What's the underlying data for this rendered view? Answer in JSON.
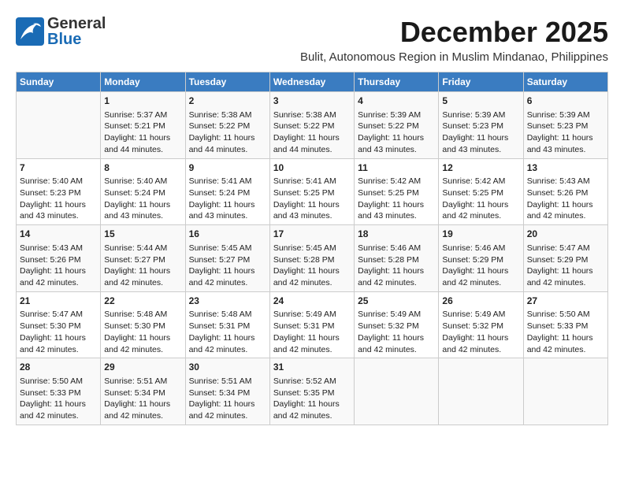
{
  "header": {
    "logo_general": "General",
    "logo_blue": "Blue",
    "month_title": "December 2025",
    "subtitle": "Bulit, Autonomous Region in Muslim Mindanao, Philippines"
  },
  "days_of_week": [
    "Sunday",
    "Monday",
    "Tuesday",
    "Wednesday",
    "Thursday",
    "Friday",
    "Saturday"
  ],
  "weeks": [
    [
      {
        "day": "",
        "info": ""
      },
      {
        "day": "1",
        "info": "Sunrise: 5:37 AM\nSunset: 5:21 PM\nDaylight: 11 hours and 44 minutes."
      },
      {
        "day": "2",
        "info": "Sunrise: 5:38 AM\nSunset: 5:22 PM\nDaylight: 11 hours and 44 minutes."
      },
      {
        "day": "3",
        "info": "Sunrise: 5:38 AM\nSunset: 5:22 PM\nDaylight: 11 hours and 44 minutes."
      },
      {
        "day": "4",
        "info": "Sunrise: 5:39 AM\nSunset: 5:22 PM\nDaylight: 11 hours and 43 minutes."
      },
      {
        "day": "5",
        "info": "Sunrise: 5:39 AM\nSunset: 5:23 PM\nDaylight: 11 hours and 43 minutes."
      },
      {
        "day": "6",
        "info": "Sunrise: 5:39 AM\nSunset: 5:23 PM\nDaylight: 11 hours and 43 minutes."
      }
    ],
    [
      {
        "day": "7",
        "info": "Sunrise: 5:40 AM\nSunset: 5:23 PM\nDaylight: 11 hours and 43 minutes."
      },
      {
        "day": "8",
        "info": "Sunrise: 5:40 AM\nSunset: 5:24 PM\nDaylight: 11 hours and 43 minutes."
      },
      {
        "day": "9",
        "info": "Sunrise: 5:41 AM\nSunset: 5:24 PM\nDaylight: 11 hours and 43 minutes."
      },
      {
        "day": "10",
        "info": "Sunrise: 5:41 AM\nSunset: 5:25 PM\nDaylight: 11 hours and 43 minutes."
      },
      {
        "day": "11",
        "info": "Sunrise: 5:42 AM\nSunset: 5:25 PM\nDaylight: 11 hours and 43 minutes."
      },
      {
        "day": "12",
        "info": "Sunrise: 5:42 AM\nSunset: 5:25 PM\nDaylight: 11 hours and 42 minutes."
      },
      {
        "day": "13",
        "info": "Sunrise: 5:43 AM\nSunset: 5:26 PM\nDaylight: 11 hours and 42 minutes."
      }
    ],
    [
      {
        "day": "14",
        "info": "Sunrise: 5:43 AM\nSunset: 5:26 PM\nDaylight: 11 hours and 42 minutes."
      },
      {
        "day": "15",
        "info": "Sunrise: 5:44 AM\nSunset: 5:27 PM\nDaylight: 11 hours and 42 minutes."
      },
      {
        "day": "16",
        "info": "Sunrise: 5:45 AM\nSunset: 5:27 PM\nDaylight: 11 hours and 42 minutes."
      },
      {
        "day": "17",
        "info": "Sunrise: 5:45 AM\nSunset: 5:28 PM\nDaylight: 11 hours and 42 minutes."
      },
      {
        "day": "18",
        "info": "Sunrise: 5:46 AM\nSunset: 5:28 PM\nDaylight: 11 hours and 42 minutes."
      },
      {
        "day": "19",
        "info": "Sunrise: 5:46 AM\nSunset: 5:29 PM\nDaylight: 11 hours and 42 minutes."
      },
      {
        "day": "20",
        "info": "Sunrise: 5:47 AM\nSunset: 5:29 PM\nDaylight: 11 hours and 42 minutes."
      }
    ],
    [
      {
        "day": "21",
        "info": "Sunrise: 5:47 AM\nSunset: 5:30 PM\nDaylight: 11 hours and 42 minutes."
      },
      {
        "day": "22",
        "info": "Sunrise: 5:48 AM\nSunset: 5:30 PM\nDaylight: 11 hours and 42 minutes."
      },
      {
        "day": "23",
        "info": "Sunrise: 5:48 AM\nSunset: 5:31 PM\nDaylight: 11 hours and 42 minutes."
      },
      {
        "day": "24",
        "info": "Sunrise: 5:49 AM\nSunset: 5:31 PM\nDaylight: 11 hours and 42 minutes."
      },
      {
        "day": "25",
        "info": "Sunrise: 5:49 AM\nSunset: 5:32 PM\nDaylight: 11 hours and 42 minutes."
      },
      {
        "day": "26",
        "info": "Sunrise: 5:49 AM\nSunset: 5:32 PM\nDaylight: 11 hours and 42 minutes."
      },
      {
        "day": "27",
        "info": "Sunrise: 5:50 AM\nSunset: 5:33 PM\nDaylight: 11 hours and 42 minutes."
      }
    ],
    [
      {
        "day": "28",
        "info": "Sunrise: 5:50 AM\nSunset: 5:33 PM\nDaylight: 11 hours and 42 minutes."
      },
      {
        "day": "29",
        "info": "Sunrise: 5:51 AM\nSunset: 5:34 PM\nDaylight: 11 hours and 42 minutes."
      },
      {
        "day": "30",
        "info": "Sunrise: 5:51 AM\nSunset: 5:34 PM\nDaylight: 11 hours and 42 minutes."
      },
      {
        "day": "31",
        "info": "Sunrise: 5:52 AM\nSunset: 5:35 PM\nDaylight: 11 hours and 42 minutes."
      },
      {
        "day": "",
        "info": ""
      },
      {
        "day": "",
        "info": ""
      },
      {
        "day": "",
        "info": ""
      }
    ]
  ]
}
